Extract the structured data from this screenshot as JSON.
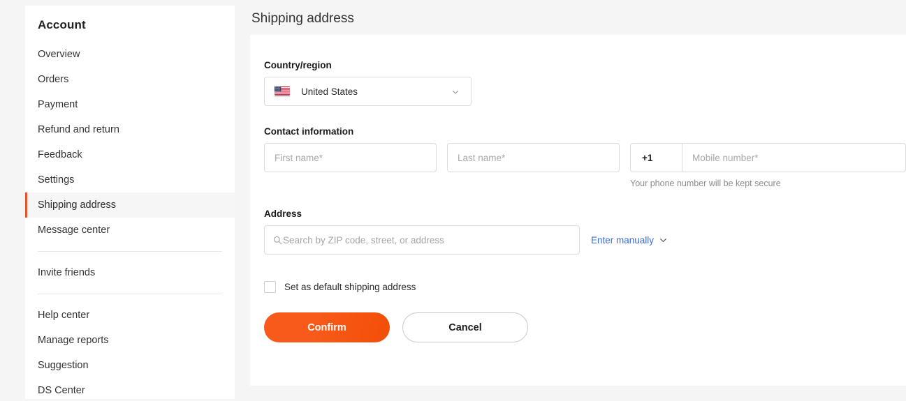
{
  "sidebar": {
    "title": "Account",
    "groups": [
      {
        "items": [
          {
            "label": "Overview",
            "active": false
          },
          {
            "label": "Orders",
            "active": false
          },
          {
            "label": "Payment",
            "active": false
          },
          {
            "label": "Refund and return",
            "active": false
          },
          {
            "label": "Feedback",
            "active": false
          },
          {
            "label": "Settings",
            "active": false
          },
          {
            "label": "Shipping address",
            "active": true
          },
          {
            "label": "Message center",
            "active": false
          }
        ]
      },
      {
        "items": [
          {
            "label": "Invite friends",
            "active": false
          }
        ]
      },
      {
        "items": [
          {
            "label": "Help center",
            "active": false
          },
          {
            "label": "Manage reports",
            "active": false
          },
          {
            "label": "Suggestion",
            "active": false
          },
          {
            "label": "DS Center",
            "active": false
          }
        ]
      }
    ]
  },
  "main": {
    "page_title": "Shipping address",
    "country": {
      "label": "Country/region",
      "selected": "United States",
      "flag_icon": "us-flag-icon",
      "chevron_icon": "chevron-down-icon"
    },
    "contact": {
      "label": "Contact information",
      "first_name_placeholder": "First name*",
      "first_name_value": "",
      "last_name_placeholder": "Last name*",
      "last_name_value": "",
      "country_code": "+1",
      "mobile_placeholder": "Mobile number*",
      "mobile_value": "",
      "phone_note": "Your phone number will be kept secure"
    },
    "address": {
      "label": "Address",
      "search_placeholder": "Search by ZIP code, street, or address",
      "search_value": "",
      "search_icon": "search-icon",
      "manual_link": "Enter manually",
      "manual_chevron_icon": "chevron-down-icon"
    },
    "default_checkbox": {
      "label": "Set as default shipping address",
      "checked": false
    },
    "buttons": {
      "confirm": "Confirm",
      "cancel": "Cancel"
    }
  },
  "colors": {
    "accent": "#e8522c",
    "confirm_gradient_start": "#f95a1d",
    "confirm_gradient_end": "#f24f08",
    "link": "#3b6ed4",
    "page_background": "#f5f5f5",
    "card_background": "#ffffff"
  }
}
